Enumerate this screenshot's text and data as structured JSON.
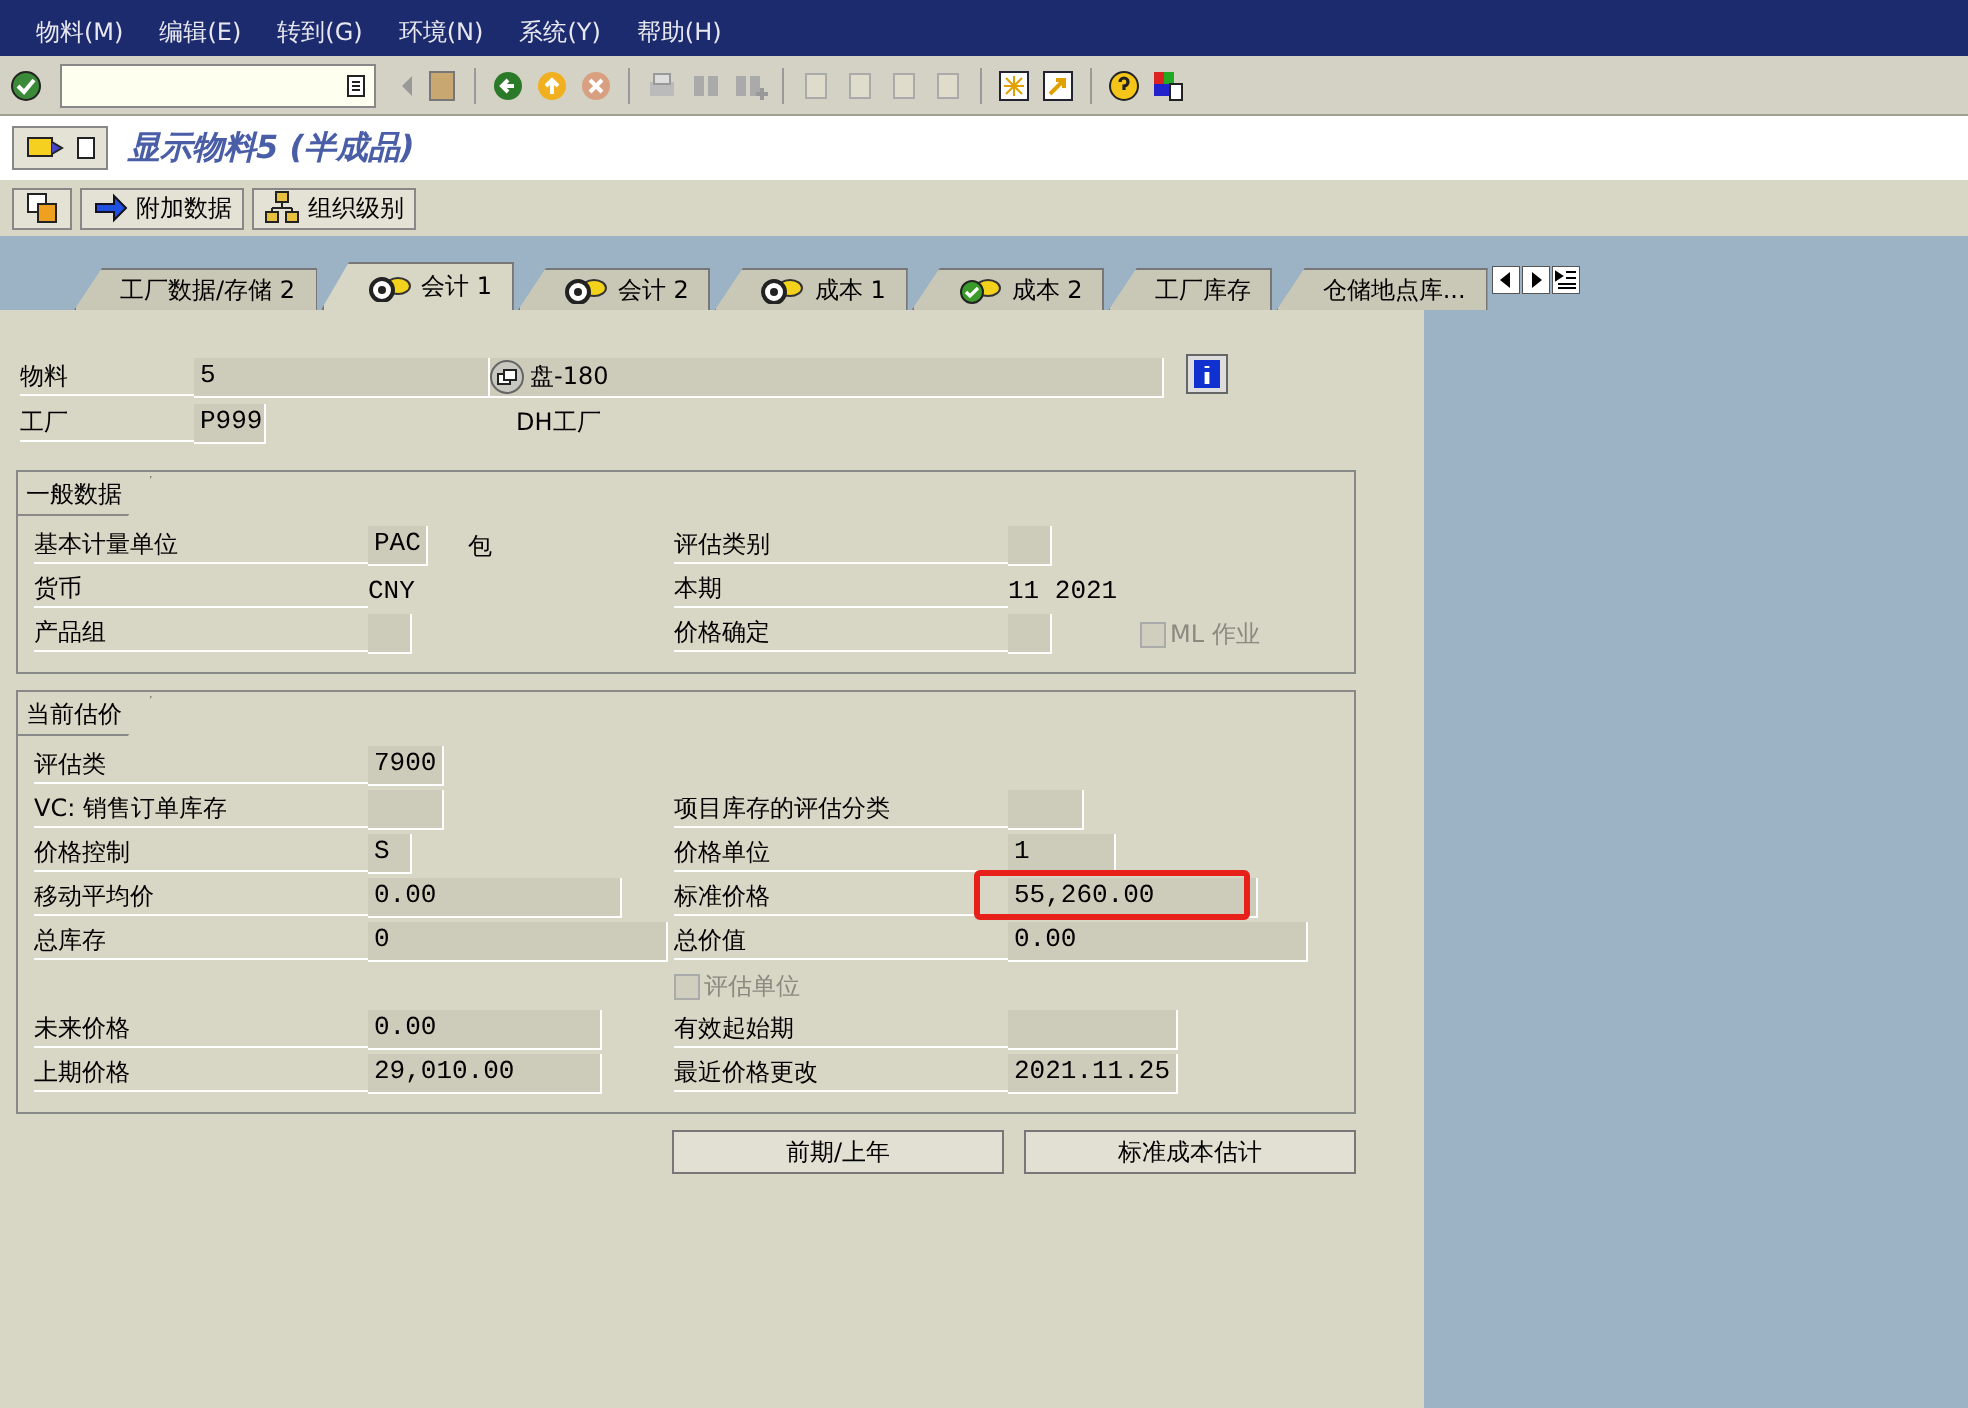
{
  "menu": [
    "物料(M)",
    "编辑(E)",
    "转到(G)",
    "环境(N)",
    "系统(Y)",
    "帮助(H)"
  ],
  "title": "显示物料5 (半成品)",
  "app_buttons": [
    "附加数据",
    "组织级别"
  ],
  "tabs": [
    {
      "label": "工厂数据/存储 2",
      "kind": "plain",
      "selected": false
    },
    {
      "label": "会计 1",
      "kind": "valuation",
      "selected": true
    },
    {
      "label": "会计 2",
      "kind": "valuation",
      "selected": false
    },
    {
      "label": "成本 1",
      "kind": "valuation",
      "selected": false
    },
    {
      "label": "成本 2",
      "kind": "approved",
      "selected": false
    },
    {
      "label": "工厂库存",
      "kind": "plain",
      "selected": false
    },
    {
      "label": "仓储地点库...",
      "kind": "plain",
      "selected": false
    }
  ],
  "header": [
    {
      "label": "物料",
      "code": "5",
      "description": "盘-180"
    },
    {
      "label": "工厂",
      "code": "P999",
      "description": "DH工厂"
    }
  ],
  "groups": [
    {
      "title": "一般数据",
      "rows": [
        {
          "left": {
            "label": "基本计量单位",
            "value": "PAC",
            "kind": "field",
            "unit": "包"
          },
          "right": {
            "label": "评估类别",
            "kind": "field"
          }
        },
        {
          "left": {
            "label": "货币",
            "value": "CNY",
            "kind": "text"
          },
          "right": {
            "label": "本期",
            "value": "11  2021",
            "kind": "text"
          }
        },
        {
          "left": {
            "label": "产品组",
            "kind": "field"
          },
          "right": {
            "label": "价格确定",
            "kind": "field",
            "checkbox": {
              "label": "ML 作业",
              "checked": false,
              "disabled": true
            }
          }
        }
      ]
    },
    {
      "title": "当前估价",
      "rows": [
        {
          "left": {
            "label": "评估类",
            "value": "7900",
            "kind": "field"
          }
        },
        {
          "left": {
            "label": "VC: 销售订单库存",
            "kind": "field"
          },
          "right": {
            "label": "项目库存的评估分类",
            "kind": "field"
          }
        },
        {
          "left": {
            "label": "价格控制",
            "value": "S",
            "kind": "field"
          },
          "right": {
            "label": "价格单位",
            "value": "1",
            "kind": "field"
          }
        },
        {
          "left": {
            "label": "移动平均价",
            "value": "0.00",
            "kind": "field"
          },
          "right": {
            "label": "标准价格",
            "value": "55,260.00",
            "kind": "field",
            "highlighted": true
          }
        },
        {
          "left": {
            "label": "总库存",
            "value": "0",
            "kind": "field"
          },
          "right": {
            "label": "总价值",
            "value": "0.00",
            "kind": "field"
          }
        },
        {
          "right": {
            "kind": "checkbox",
            "label": "评估单位",
            "checked": false,
            "disabled": true
          }
        },
        {
          "left": {
            "label": "未来价格",
            "value": "0.00",
            "kind": "field"
          },
          "right": {
            "label": "有效起始期",
            "kind": "field"
          }
        },
        {
          "left": {
            "label": "上期价格",
            "value": "29,010.00",
            "kind": "field"
          },
          "right": {
            "label": "最近价格更改",
            "value": "2021.11.25",
            "kind": "field"
          }
        }
      ]
    }
  ],
  "buttons": [
    "前期/上年",
    "标准成本估计"
  ]
}
